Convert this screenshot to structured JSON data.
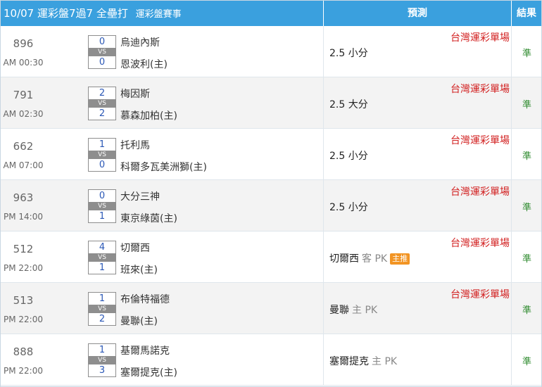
{
  "header": {
    "date": "10/07",
    "title": "運彩盤7過7 全壘打",
    "subtitle": "運彩盤賽事",
    "prediction_label": "預測",
    "result_label": "結果"
  },
  "vs_label": "VS",
  "rows": [
    {
      "id": "896",
      "time": "AM 00:30",
      "away_team": "烏迪內斯",
      "home_team": "恩波利(主)",
      "away_score": "0",
      "home_score": "0",
      "venue": "台灣運彩單場",
      "pick": "2.5 小分",
      "pick_side": "",
      "badge": "",
      "result": "準"
    },
    {
      "id": "791",
      "time": "AM 02:30",
      "away_team": "梅因斯",
      "home_team": "慕森加柏(主)",
      "away_score": "2",
      "home_score": "2",
      "venue": "台灣運彩單場",
      "pick": "2.5 大分",
      "pick_side": "",
      "badge": "",
      "result": "準"
    },
    {
      "id": "662",
      "time": "AM 07:00",
      "away_team": "托利馬",
      "home_team": "科爾多瓦美洲獅(主)",
      "away_score": "1",
      "home_score": "0",
      "venue": "台灣運彩單場",
      "pick": "2.5 小分",
      "pick_side": "",
      "badge": "",
      "result": "準"
    },
    {
      "id": "963",
      "time": "PM 14:00",
      "away_team": "大分三神",
      "home_team": "東京綠茵(主)",
      "away_score": "0",
      "home_score": "1",
      "venue": "台灣運彩單場",
      "pick": "2.5 小分",
      "pick_side": "",
      "badge": "",
      "result": "準"
    },
    {
      "id": "512",
      "time": "PM 22:00",
      "away_team": "切爾西",
      "home_team": "班來(主)",
      "away_score": "4",
      "home_score": "1",
      "venue": "台灣運彩單場",
      "pick": "切爾西",
      "pick_side": "客 PK",
      "badge": "主推",
      "result": "準"
    },
    {
      "id": "513",
      "time": "PM 22:00",
      "away_team": "布倫特福德",
      "home_team": "曼聯(主)",
      "away_score": "1",
      "home_score": "2",
      "venue": "台灣運彩單場",
      "pick": "曼聯",
      "pick_side": "主 PK",
      "badge": "",
      "result": "準"
    },
    {
      "id": "888",
      "time": "PM 22:00",
      "away_team": "基爾馬諾克",
      "home_team": "塞爾提克(主)",
      "away_score": "1",
      "home_score": "3",
      "venue": "",
      "pick": "塞爾提克",
      "pick_side": "主 PK",
      "badge": "",
      "result": "準"
    }
  ],
  "colors": {
    "header_bg": "#3aa0de",
    "venue_red": "#d22020",
    "result_green": "#2f8b2f",
    "badge_orange": "#f29423",
    "score_blue": "#2b58b6"
  }
}
